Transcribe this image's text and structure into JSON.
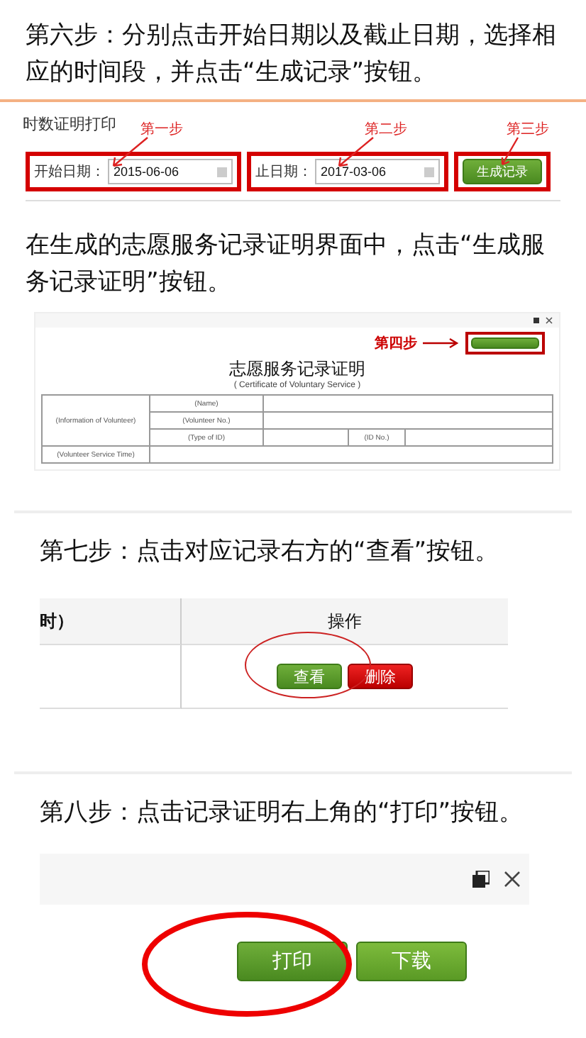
{
  "steps": [
    {
      "kind": "date-range",
      "instruction": "第六步：分别点击开始日期以及截止日期，选择相应的时间段，并点击“生成记录”按钮。",
      "panel_title": "时数证明打印",
      "start_label": "开始日期：",
      "start_value": "2015-06-06",
      "end_label": "止日期：",
      "end_value": "2017-03-06",
      "button": "生成记录",
      "callouts": [
        "第一步",
        "第二步",
        "第三步"
      ]
    },
    {
      "kind": "certificate",
      "instruction": "在生成的志愿服务记录证明界面中，点击“生成服务记录证明”按钮。",
      "callout": "第四步",
      "heading": "志愿服务记录证明",
      "subtitle": "( Certificate of Voluntary Service )",
      "cells": [
        "(Information of Volunteer)",
        "(Name)",
        "(Volunteer No.)",
        "(Type of ID)",
        "(ID No.)",
        "(Volunteer Service Time)"
      ]
    },
    {
      "kind": "record-table",
      "instruction": "第七步：点击对应记录右方的“查看”按钮。",
      "column_1": "时）",
      "column_2": "操作",
      "view_button": "查看",
      "delete_button": "删除"
    },
    {
      "kind": "print-dialog",
      "instruction": "第八步：点击记录证明右上角的“打印”按钮。",
      "print_button": "打印",
      "download_button": "下载"
    }
  ]
}
